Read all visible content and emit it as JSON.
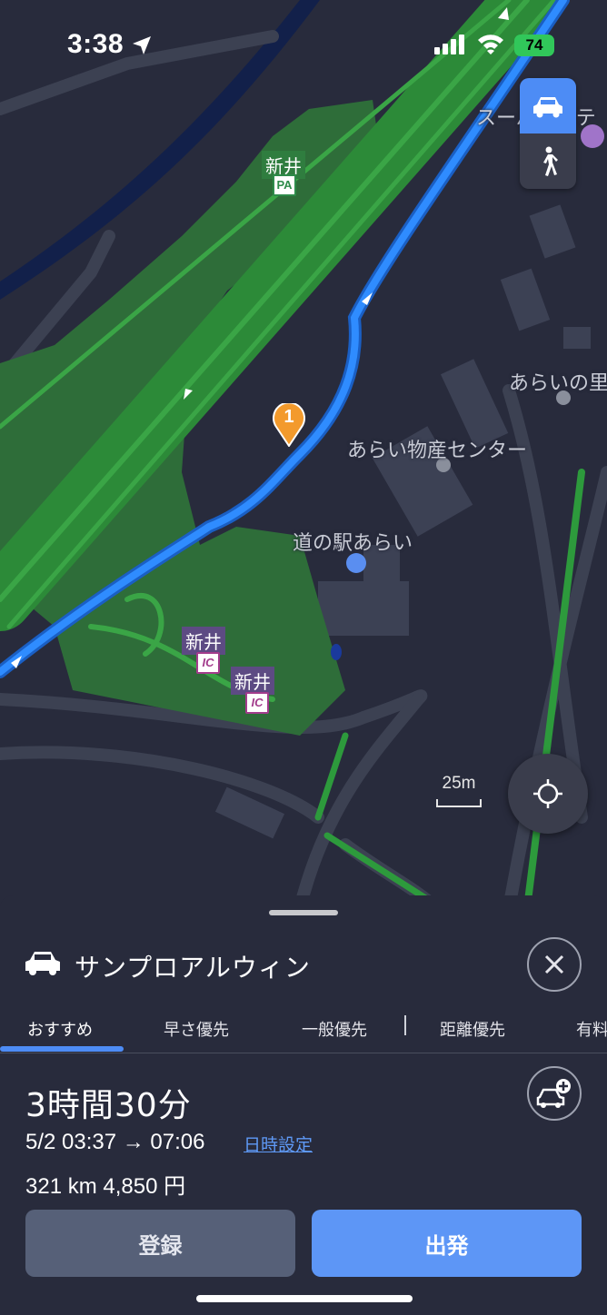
{
  "status_bar": {
    "time": "3:38",
    "battery": "74",
    "icons": [
      "location-arrow-icon",
      "cellular-signal-icon",
      "wifi-icon",
      "battery-charging-icon"
    ]
  },
  "map": {
    "labels": {
      "super_hotel": "スーパーホテ",
      "arai_no_sato": "あらいの里",
      "bussan_center": "あらい物産センター",
      "michinoeki": "道の駅あらい"
    },
    "poi": {
      "pa_name": "新井",
      "pa_badge": "PA",
      "ic1_name": "新井",
      "ic2_name": "新井",
      "ic_badge": "IC"
    },
    "waypoint_number": "1",
    "scale_label": "25m",
    "colors": {
      "route": "#2f8cff",
      "highway": "#2f8f3a",
      "greenery": "#2e6e3a",
      "background": "#282b3c"
    }
  },
  "mode_toggle": {
    "modes": [
      "car-icon",
      "walk-icon"
    ],
    "active": "car"
  },
  "sheet": {
    "destination": "サンプロアルウィン",
    "tabs": [
      "おすすめ",
      "早さ優先",
      "一般優先",
      "距離優先",
      "有料"
    ],
    "active_tab": "おすすめ",
    "duration": "3時間30分",
    "departure_arrival": "5/2 03:37 → 07:06",
    "datetime_link": "日時設定",
    "distance_fee": "321 km  4,850 円",
    "save_label": "登録",
    "go_label": "出発"
  }
}
